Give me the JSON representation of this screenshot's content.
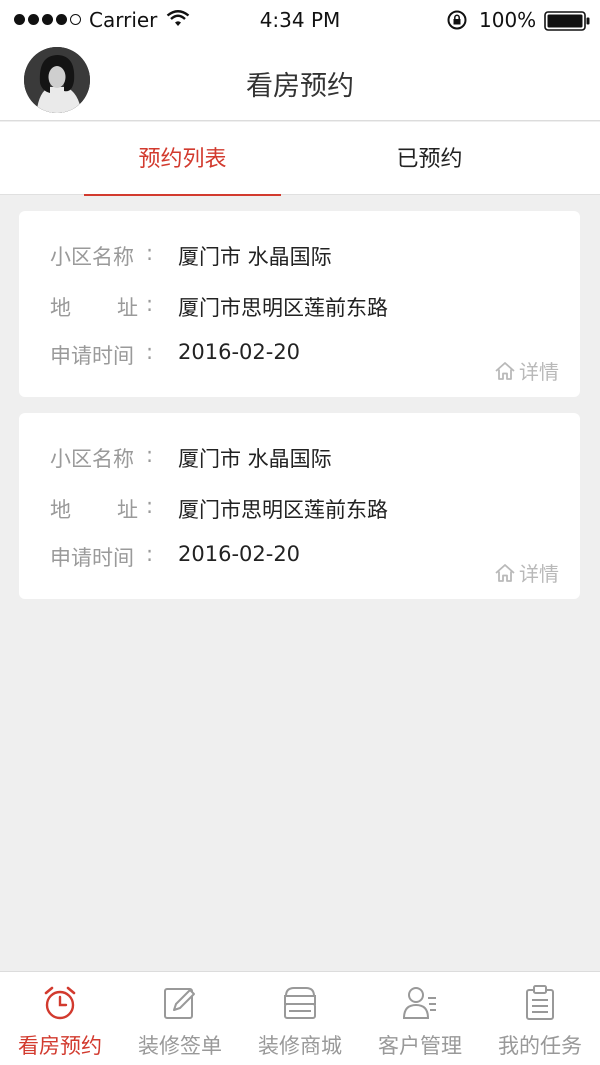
{
  "status_bar": {
    "carrier": "Carrier",
    "time": "4:34 PM",
    "battery": "100%"
  },
  "header": {
    "title": "看房预约"
  },
  "tabs": [
    {
      "label": "预约列表",
      "active": true
    },
    {
      "label": "已预约",
      "active": false
    }
  ],
  "cards": [
    {
      "community_label": "小区名称",
      "community_value": "厦门市  水晶国际",
      "address_label_1": "地",
      "address_label_2": "址",
      "address_value": "厦门市思明区莲前东路",
      "time_label": "申请时间",
      "time_value": "2016-02-20",
      "detail_label": "详情",
      "colon": ":"
    },
    {
      "community_label": "小区名称",
      "community_value": "厦门市  水晶国际",
      "address_label_1": "地",
      "address_label_2": "址",
      "address_value": "厦门市思明区莲前东路",
      "time_label": "申请时间",
      "time_value": "2016-02-20",
      "detail_label": "详情",
      "colon": ":"
    }
  ],
  "tabbar": [
    {
      "label": "看房预约",
      "icon": "alarm-clock-icon",
      "active": true
    },
    {
      "label": "装修签单",
      "icon": "edit-icon",
      "active": false
    },
    {
      "label": "装修商城",
      "icon": "store-icon",
      "active": false
    },
    {
      "label": "客户管理",
      "icon": "contacts-icon",
      "active": false
    },
    {
      "label": "我的任务",
      "icon": "clipboard-icon",
      "active": false
    }
  ],
  "colors": {
    "accent": "#d23a2e",
    "inactive": "#999999",
    "background": "#efefef"
  }
}
